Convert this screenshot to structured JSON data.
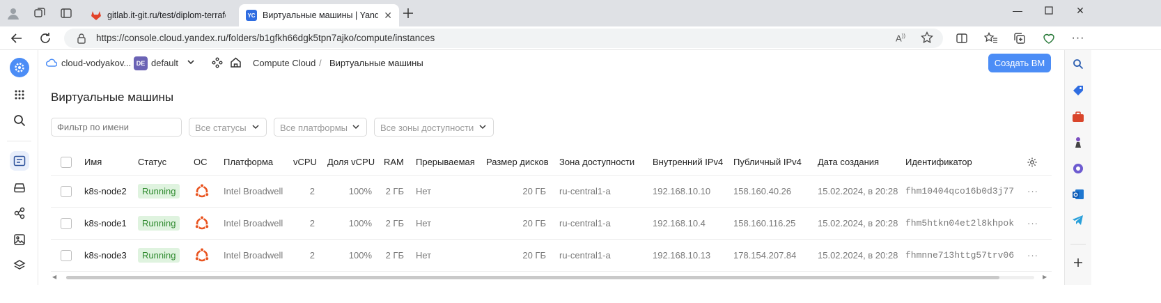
{
  "browser": {
    "tabs": [
      {
        "title": "gitlab.it-git.ru/test/diplom-terrafo",
        "favicon": "gitlab-icon",
        "color": "#e2432a"
      },
      {
        "title": "Виртуальные машины | Yandex Clo",
        "favicon_text": "YC",
        "color": "#2f6de1",
        "active": true
      }
    ],
    "url": "https://console.cloud.yandex.ru/folders/b1gfkh66dgk5tpn7ajko/compute/instances"
  },
  "header": {
    "cloud_name": "cloud-vodyakov...",
    "folder_badge": "DE",
    "folder_name": "default",
    "breadcrumb_service": "Compute Cloud",
    "breadcrumb_separator": "/",
    "breadcrumb_page": "Виртуальные машины",
    "create_button": "Создать ВМ"
  },
  "page": {
    "title": "Виртуальные машины",
    "filters": {
      "name_placeholder": "Фильтр по имени",
      "status": "Все статусы",
      "platform": "Все платформы",
      "zone": "Все зоны доступности"
    }
  },
  "table": {
    "columns": [
      "Имя",
      "Статус",
      "ОС",
      "Платформа",
      "vCPU",
      "Доля vCPU",
      "RAM",
      "Прерываемая",
      "Размер дисков",
      "Зона доступности",
      "Внутренний IPv4",
      "Публичный IPv4",
      "Дата создания",
      "Идентификатор"
    ],
    "rows": [
      {
        "name": "k8s-node2",
        "status": "Running",
        "os": "ubuntu-icon",
        "platform": "Intel Broadwell",
        "vcpu": "2",
        "share": "100%",
        "ram": "2 ГБ",
        "preemptible": "Нет",
        "disk": "20 ГБ",
        "zone": "ru-central1-a",
        "ip_int": "192.168.10.10",
        "ip_pub": "158.160.40.26",
        "created": "15.02.2024, в 20:28",
        "id": "fhm10404qco16b0d3j77"
      },
      {
        "name": "k8s-node1",
        "status": "Running",
        "os": "ubuntu-icon",
        "platform": "Intel Broadwell",
        "vcpu": "2",
        "share": "100%",
        "ram": "2 ГБ",
        "preemptible": "Нет",
        "disk": "20 ГБ",
        "zone": "ru-central1-a",
        "ip_int": "192.168.10.4",
        "ip_pub": "158.160.116.25",
        "created": "15.02.2024, в 20:28",
        "id": "fhm5htkn04et2l8khpok"
      },
      {
        "name": "k8s-node3",
        "status": "Running",
        "os": "ubuntu-icon",
        "platform": "Intel Broadwell",
        "vcpu": "2",
        "share": "100%",
        "ram": "2 ГБ",
        "preemptible": "Нет",
        "disk": "20 ГБ",
        "zone": "ru-central1-a",
        "ip_int": "192.168.10.13",
        "ip_pub": "178.154.207.84",
        "created": "15.02.2024, в 20:28",
        "id": "fhmnne713httg57trv06"
      }
    ]
  },
  "colors": {
    "accent": "#4c8df6",
    "running_bg": "#dff3df",
    "running_text": "#2e8a2e",
    "ubuntu": "#e95420"
  }
}
